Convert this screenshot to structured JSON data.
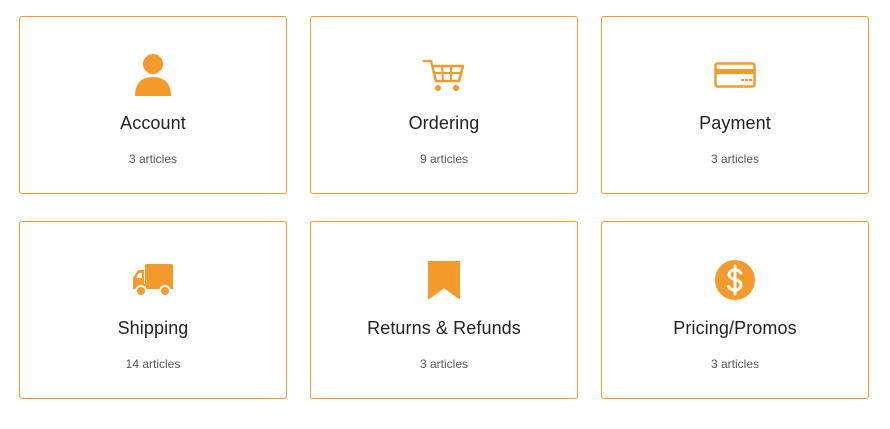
{
  "accent_color": "#f39a2a",
  "categories": [
    {
      "title": "Account",
      "count": "3 articles",
      "icon": "user-icon"
    },
    {
      "title": "Ordering",
      "count": "9 articles",
      "icon": "shopping-cart-icon"
    },
    {
      "title": "Payment",
      "count": "3 articles",
      "icon": "credit-card-icon"
    },
    {
      "title": "Shipping",
      "count": "14 articles",
      "icon": "truck-icon"
    },
    {
      "title": "Returns & Refunds",
      "count": "3 articles",
      "icon": "bookmark-icon"
    },
    {
      "title": "Pricing/Promos",
      "count": "3 articles",
      "icon": "dollar-circle-icon"
    }
  ]
}
